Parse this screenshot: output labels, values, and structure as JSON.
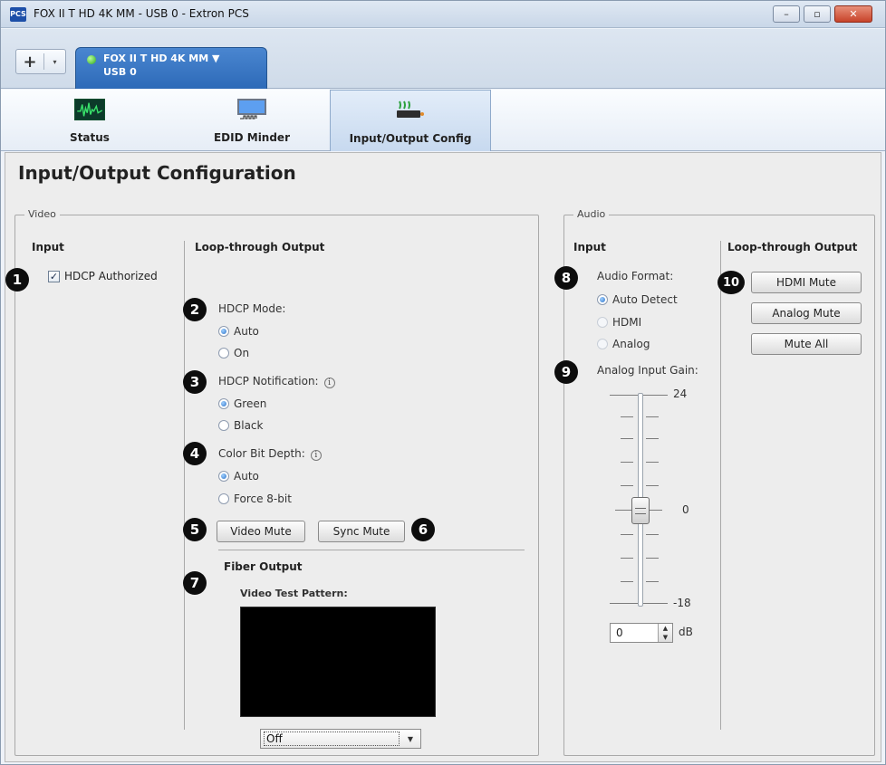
{
  "window": {
    "title": "FOX II T HD 4K MM - USB 0 - Extron PCS",
    "app_icon_text": "PCS",
    "controls": {
      "minimize": "–",
      "maximize": "▫",
      "close": "✕"
    }
  },
  "device_tab": {
    "add_symbol": "+",
    "add_dropdown": "▾",
    "name": "FOX II T HD 4K MM ▼",
    "port": "USB 0",
    "status_color": "#2ca61d"
  },
  "toolbar": {
    "tabs": [
      {
        "label": "Status",
        "icon": "waveform-monitor-icon"
      },
      {
        "label": "EDID Minder",
        "icon": "edid-monitor-icon"
      },
      {
        "label": "Input/Output Config",
        "icon": "io-config-icon",
        "active": true
      }
    ]
  },
  "page": {
    "title": "Input/Output Configuration"
  },
  "video": {
    "legend": "Video",
    "input": {
      "title": "Input",
      "hdcp_authorized": {
        "label": "HDCP Authorized",
        "checked": true,
        "mark": "✓"
      }
    },
    "loop_output": {
      "title": "Loop-through Output",
      "hdcp_mode": {
        "label": "HDCP Mode:",
        "options": [
          "Auto",
          "On"
        ],
        "selected": "Auto"
      },
      "hdcp_notification": {
        "label": "HDCP Notification:",
        "info": "i",
        "options": [
          "Green",
          "Black"
        ],
        "selected": "Green"
      },
      "color_bit_depth": {
        "label": "Color Bit Depth:",
        "info": "i",
        "options": [
          "Auto",
          "Force 8-bit"
        ],
        "selected": "Auto"
      },
      "video_mute_label": "Video Mute",
      "sync_mute_label": "Sync Mute"
    },
    "fiber_output": {
      "title": "Fiber Output",
      "test_pattern_label": "Video Test Pattern:",
      "test_pattern_value": "Off",
      "caret": "▼"
    }
  },
  "audio": {
    "legend": "Audio",
    "input": {
      "title": "Input",
      "format": {
        "label": "Audio Format:",
        "options": [
          "Auto Detect",
          "HDMI",
          "Analog"
        ],
        "selected": "Auto Detect"
      },
      "gain": {
        "label": "Analog Input Gain:",
        "max": "24",
        "mid": "0",
        "min": "-18",
        "value": "0",
        "unit": "dB",
        "level": 0
      }
    },
    "loop_output": {
      "title": "Loop-through Output",
      "hdmi_mute_label": "HDMI Mute",
      "analog_mute_label": "Analog Mute",
      "mute_all_label": "Mute All"
    }
  },
  "callouts": [
    "1",
    "2",
    "3",
    "4",
    "5",
    "6",
    "7",
    "8",
    "9",
    "10"
  ]
}
